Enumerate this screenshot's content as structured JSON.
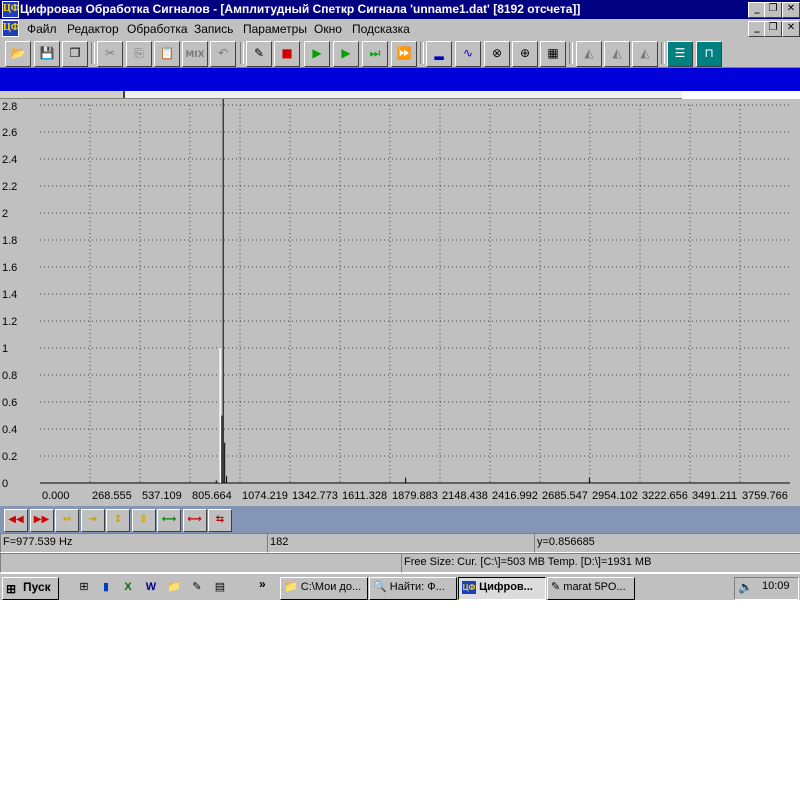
{
  "window": {
    "title": "Цифровая Обработка Сигналов - [Амплитудный Спеткр Сигнала 'unname1.dat' [8192 отсчета]]",
    "app_icon": "ЦФ"
  },
  "caption_buttons": [
    "_",
    "❐",
    "✕"
  ],
  "menu": [
    "Файл",
    "Редактор",
    "Обработка",
    "Запись",
    "Параметры",
    "Окно",
    "Подсказка"
  ],
  "toolbar_icons": [
    "open-icon",
    "save-icon",
    "save-all-icon",
    "cut-icon",
    "copy-icon",
    "paste-icon",
    "mix-icon",
    "undo-icon",
    "probe-icon",
    "record-icon",
    "play-icon",
    "play-step-icon",
    "play-to-end-icon",
    "play-loop-icon",
    "spectrum-icon",
    "sine-icon",
    "filter-icon",
    "transform-icon",
    "bars-icon",
    "wave-1-icon",
    "wave-2-icon",
    "wave-3-icon",
    "channels-icon",
    "square-wave-icon"
  ],
  "toolbar_glyphs": [
    "📂",
    "💾",
    "❐",
    "✂",
    "⎘",
    "📋",
    "MIX",
    "↶",
    "✎",
    "■",
    "▶",
    "▶",
    "⏭",
    "⏩",
    "▂",
    "∿",
    "⊗",
    "⊕",
    "▦",
    "◭",
    "◭",
    "◭",
    "☰",
    "⊓"
  ],
  "mix_label": "MIX",
  "chart_data": {
    "type": "line",
    "x_ticks": [
      "0.000",
      "268.555",
      "537.109",
      "805.664",
      "1074.219",
      "1342.773",
      "1611.328",
      "1879.883",
      "2148.438",
      "2416.992",
      "2685.547",
      "2954.102",
      "3222.656",
      "3491.211",
      "3759.766"
    ],
    "y_ticks": [
      "0",
      "0.2",
      "0.4",
      "0.6",
      "0.8",
      "1",
      "1.2",
      "1.4",
      "1.6",
      "1.8",
      "2",
      "2.2",
      "2.4",
      "2.6",
      "2.8"
    ],
    "xlim": [
      0,
      4000
    ],
    "ylim": [
      0,
      2.8
    ],
    "grid": true,
    "line_color": "#000000",
    "cursor_color": "#ffffff",
    "cursor_x": 977.539,
    "peaks": [
      {
        "x": 940,
        "y": 0.02
      },
      {
        "x": 960,
        "y": 0.1
      },
      {
        "x": 970,
        "y": 0.5
      },
      {
        "x": 977,
        "y": 2.85
      },
      {
        "x": 985,
        "y": 0.3
      },
      {
        "x": 995,
        "y": 0.05
      },
      {
        "x": 1950,
        "y": 0.04
      },
      {
        "x": 2930,
        "y": 0.04
      }
    ]
  },
  "nav_buttons": [
    {
      "glyph": "◀◀",
      "color": "#d00000"
    },
    {
      "glyph": "▶▶",
      "color": "#d00000"
    },
    {
      "glyph": "↔",
      "color": "#d0a000"
    },
    {
      "glyph": "⇥",
      "color": "#d0a000"
    },
    {
      "glyph": "↕",
      "color": "#d0a000"
    },
    {
      "glyph": "⇕",
      "color": "#d0a000"
    },
    {
      "glyph": "⟷",
      "color": "#008000"
    },
    {
      "glyph": "⟷",
      "color": "#c00000"
    },
    {
      "glyph": "⇆",
      "color": "#c00000"
    }
  ],
  "status": {
    "frequency": "F=977.539 Hz",
    "index": "182",
    "value": "y=0.856685",
    "free_size": "Free Size: Cur. [C:\\]=503 MB Temp. [D:\\]=1931 MB"
  },
  "taskbar": {
    "start": "Пуск",
    "chevron": "»",
    "quick_glyphs": [
      "⊞",
      "▮",
      "X",
      "W",
      "📁",
      "✎",
      "▤"
    ],
    "tasks": [
      {
        "label": "C:\\Мои до...",
        "icon": "📁"
      },
      {
        "label": "Найти: Ф...",
        "icon": "🔍"
      },
      {
        "label": "Цифров...",
        "icon": "ЦФ"
      },
      {
        "label": "marat 5PO...",
        "icon": "✎"
      }
    ],
    "clock": "10:09",
    "speaker": "🔈"
  }
}
